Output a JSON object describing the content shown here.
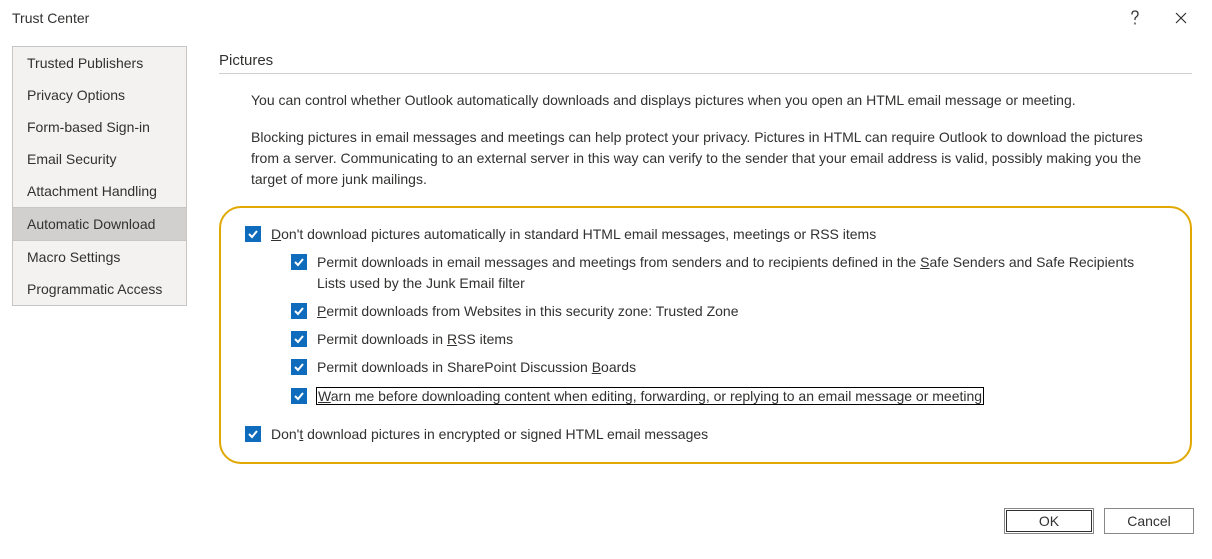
{
  "window": {
    "title": "Trust Center"
  },
  "sidebar": {
    "items": [
      {
        "label": "Trusted Publishers",
        "selected": false
      },
      {
        "label": "Privacy Options",
        "selected": false
      },
      {
        "label": "Form-based Sign-in",
        "selected": false
      },
      {
        "label": "Email Security",
        "selected": false
      },
      {
        "label": "Attachment Handling",
        "selected": false
      },
      {
        "label": "Automatic Download",
        "selected": true
      },
      {
        "label": "Macro Settings",
        "selected": false
      },
      {
        "label": "Programmatic Access",
        "selected": false
      }
    ]
  },
  "main": {
    "section_title": "Pictures",
    "intro": "You can control whether Outlook automatically downloads and displays pictures when you open an HTML email message or meeting.",
    "explain": "Blocking pictures in email messages and meetings can help protect your privacy. Pictures in HTML can require Outlook to download the pictures from a server. Communicating to an external server in this way can verify to the sender that your email address is valid, possibly making you the target of more junk mailings.",
    "options": {
      "root": {
        "pre": "",
        "u": "D",
        "post": "on't download pictures automatically in standard HTML email messages, meetings or RSS items"
      },
      "safe": {
        "pre": "Permit downloads in email messages and meetings from senders and to recipients defined in the ",
        "u": "S",
        "post": "afe Senders and Safe Recipients Lists used by the Junk Email filter"
      },
      "zone": {
        "pre": "",
        "u": "P",
        "post": "ermit downloads from Websites in this security zone: Trusted Zone"
      },
      "rss": {
        "pre": "Permit downloads in ",
        "u": "R",
        "post": "SS items"
      },
      "boards": {
        "pre": "Permit downloads in SharePoint Discussion ",
        "u": "B",
        "post": "oards"
      },
      "warn": {
        "pre": "",
        "u": "W",
        "post": "arn me before downloading content when editing, forwarding, or replying to an email message or meeting"
      },
      "encrypted": {
        "pre": "Don'",
        "u": "t",
        "post": " download pictures in encrypted or signed HTML email messages"
      }
    }
  },
  "footer": {
    "ok": "OK",
    "cancel": "Cancel"
  }
}
